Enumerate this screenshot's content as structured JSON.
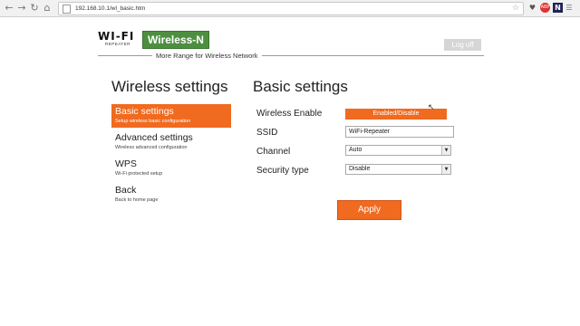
{
  "browser": {
    "back_icon": "arrow-left-icon",
    "forward_icon": "arrow-right-icon",
    "reload_icon": "reload-icon",
    "home_icon": "home-icon",
    "url": "192.168.10.1/wl_basic.htm",
    "extensions": [
      "heart-icon",
      "abp-icon",
      "n-icon",
      "bookmark-icon",
      "menu-icon"
    ]
  },
  "header": {
    "logo_text": "WI-FI",
    "logo_sub": "REPEATER",
    "product": "Wireless-N",
    "tagline": "More Range for Wireless Network",
    "logoff_label": "Log off"
  },
  "left": {
    "heading": "Wireless settings",
    "menu": [
      {
        "title": "Basic settings",
        "desc": "Setup wireless basic configuration",
        "active": true
      },
      {
        "title": "Advanced settings",
        "desc": "Wireless advanced configuration",
        "active": false
      },
      {
        "title": "WPS",
        "desc": "Wi-Fi protected setup",
        "active": false
      },
      {
        "title": "Back",
        "desc": "Back to home page",
        "active": false
      }
    ]
  },
  "main": {
    "heading": "Basic settings",
    "wireless_enable": {
      "label": "Wireless Enable",
      "value": "Enabled/Disable"
    },
    "ssid": {
      "label": "SSID",
      "value": "WiFi-Repeater"
    },
    "channel": {
      "label": "Channel",
      "value": "Auto"
    },
    "security": {
      "label": "Security type",
      "value": "Disable"
    },
    "apply_label": "Apply"
  },
  "colors": {
    "accent": "#f06a1f",
    "brand_green": "#4d8f3f"
  }
}
